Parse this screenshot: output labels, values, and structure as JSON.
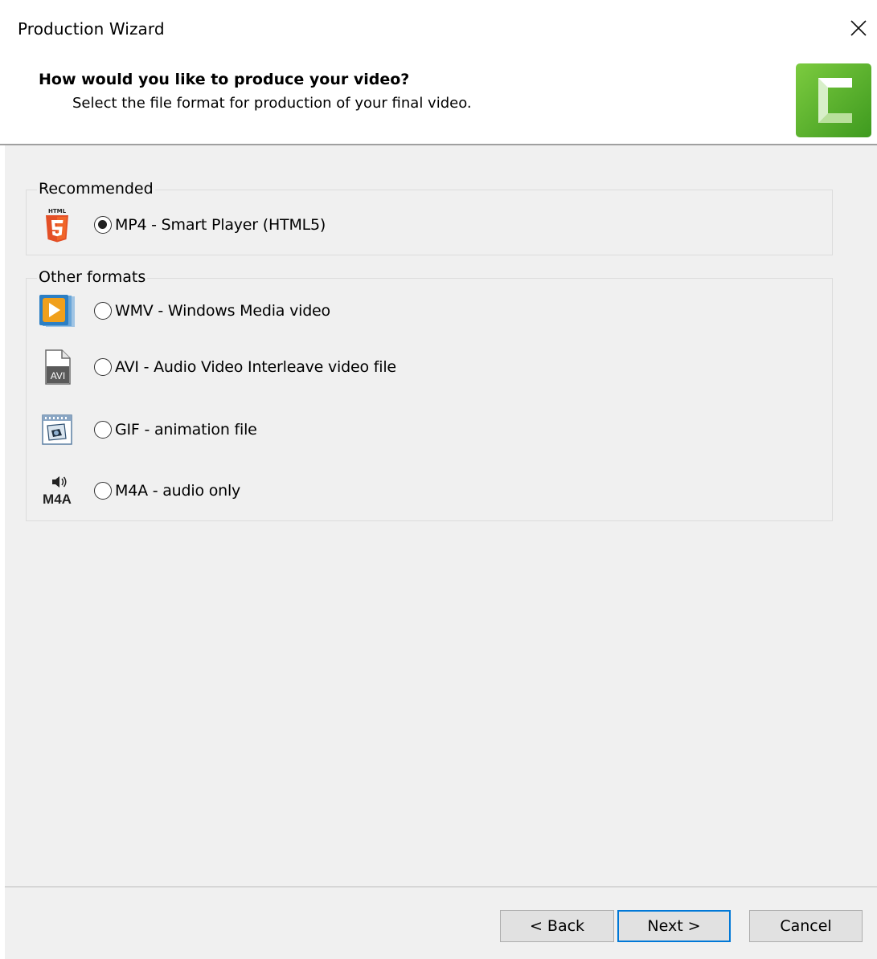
{
  "window": {
    "title": "Production Wizard"
  },
  "header": {
    "title": "How would you like to produce your video?",
    "subtitle": "Select the file format for production of your final video."
  },
  "groups": {
    "recommended": {
      "legend": "Recommended",
      "options": [
        {
          "label": "MP4 - Smart Player (HTML5)",
          "icon": "html5-icon",
          "checked": true
        }
      ]
    },
    "other": {
      "legend": "Other formats",
      "options": [
        {
          "label": "WMV - Windows Media video",
          "icon": "wmv-media-icon",
          "checked": false
        },
        {
          "label": "AVI - Audio Video Interleave video file",
          "icon": "avi-file-icon",
          "checked": false,
          "icon_text": "AVI"
        },
        {
          "label": "GIF - animation file",
          "icon": "gif-animation-icon",
          "checked": false
        },
        {
          "label": "M4A - audio only",
          "icon": "m4a-audio-icon",
          "checked": false,
          "icon_text": "M4A"
        }
      ]
    }
  },
  "footer": {
    "back_label": "< Back",
    "next_label": "Next >",
    "cancel_label": "Cancel"
  },
  "colors": {
    "brand_green": "#5cb82a",
    "html5_orange": "#e34f26",
    "focus_blue": "#0078d7",
    "dialog_gray": "#f0f0f0"
  }
}
